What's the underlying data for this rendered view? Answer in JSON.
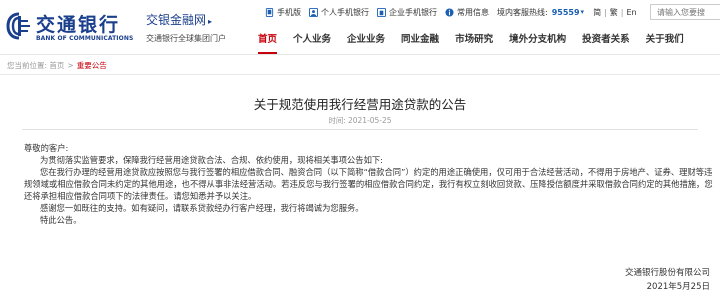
{
  "header": {
    "logo": {
      "name_cn": "交通银行",
      "name_en": "BANK OF COMMUNICATIONS"
    },
    "subsite": {
      "title": "交银金融网",
      "arrow": "▸",
      "subtitle": "交通银行全球集团门户"
    },
    "top_links": [
      {
        "icon": "tablet-icon",
        "label": "手机版"
      },
      {
        "icon": "person-icon",
        "label": "个人手机银行"
      },
      {
        "icon": "enterprise-icon",
        "label": "企业手机银行"
      },
      {
        "icon": "info-icon",
        "label": "常用信息"
      }
    ],
    "hotline": {
      "label": "境内客服热线:",
      "number": "95559",
      "caret": "▾"
    },
    "language": {
      "simplified": "简",
      "traditional": "繁",
      "english": "En"
    },
    "search": {
      "placeholder": "请输入您要搜"
    },
    "nav": [
      {
        "label": "首页",
        "active": true
      },
      {
        "label": "个人业务"
      },
      {
        "label": "企业业务"
      },
      {
        "label": "同业金融"
      },
      {
        "label": "市场研究"
      },
      {
        "label": "境外分支机构"
      },
      {
        "label": "投资者关系"
      },
      {
        "label": "关于我们"
      }
    ]
  },
  "breadcrumb": {
    "prefix": "您当前位置:",
    "home": "首页",
    "separator": ">",
    "current": "重要公告"
  },
  "article": {
    "title": "关于规范使用我行经营用途贷款的公告",
    "date_label": "时间:",
    "date": "2021-05-25",
    "greeting": "尊敬的客户:",
    "paragraphs": [
      "为贯彻落实监管要求，保障我行经营用途贷款合法、合规、依约使用，现将相关事项公告如下:",
      "您在我行办理的经营用途贷款应按照您与我行签署的相应借款合同、融资合同（以下简称“借款合同”）约定的用途正确使用，仅可用于合法经营活动，不得用于房地产、证券、理财等违规领域或相应借款合同未约定的其他用途，也不得从事非法经营活动。若违反您与我行签署的相应借款合同约定，我行有权立刻收回贷款、压降授信额度并采取借款合同约定的其他措施，您还将承担相应借款合同项下的法律责任。请您知悉并予以关注。",
      "感谢您一如既往的支持。如有疑问，请联系贷款经办行客户经理，我行将竭诚为您服务。",
      "特此公告。"
    ],
    "signature": "交通银行股份有限公司",
    "signature_date": "2021年5月25日"
  },
  "colors": {
    "brand_blue": "#1a3f8c",
    "accent_red": "#c7000b",
    "link_blue": "#1a5fb4"
  }
}
